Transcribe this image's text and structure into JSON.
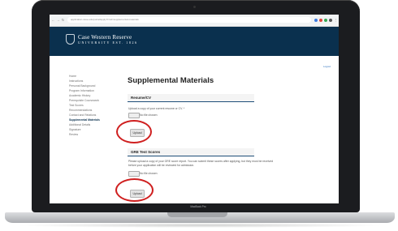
{
  "browser": {
    "url": "application.case.edu/portal/apply?cmd=supplemental-materials"
  },
  "banner": {
    "brand_line1": "Case Western Reserve",
    "brand_line2": "UNIVERSITY EST. 1826"
  },
  "sidebar": {
    "items": [
      {
        "label": "Home"
      },
      {
        "label": "Instructions"
      },
      {
        "label": "Personal Background"
      },
      {
        "label": "Program Information"
      },
      {
        "label": "Academic History"
      },
      {
        "label": "Prerequisite Coursework"
      },
      {
        "label": "Test Scores"
      },
      {
        "label": "Recommendations"
      },
      {
        "label": "Contact and Relations"
      },
      {
        "label": "Supplemental Materials"
      },
      {
        "label": "Additional Details"
      },
      {
        "label": "Signature"
      },
      {
        "label": "Review"
      }
    ]
  },
  "main": {
    "top_link": "Logout",
    "title": "Supplemental Materials",
    "section1": {
      "heading": "Resume/CV",
      "instruction": "Upload a copy of your current resume or CV. *",
      "file_button": "Choose File",
      "file_status": "No file chosen",
      "upload_label": "Upload"
    },
    "section2": {
      "heading": "GRE Test Scores",
      "instruction_line1": "Please upload a copy of your GRE score report. You can submit these scores after applying, but they must be received",
      "instruction_line2": "before your application will be reviewed for admission.",
      "file_button": "Choose File",
      "file_status": "No file chosen",
      "upload_label": "Upload"
    }
  },
  "laptop": {
    "model_label": "MacBook Pro"
  },
  "colors": {
    "banner": "#0a304e",
    "highlight_ring": "#cf1f1f",
    "laptop_bezel": "#1b1c1f"
  }
}
